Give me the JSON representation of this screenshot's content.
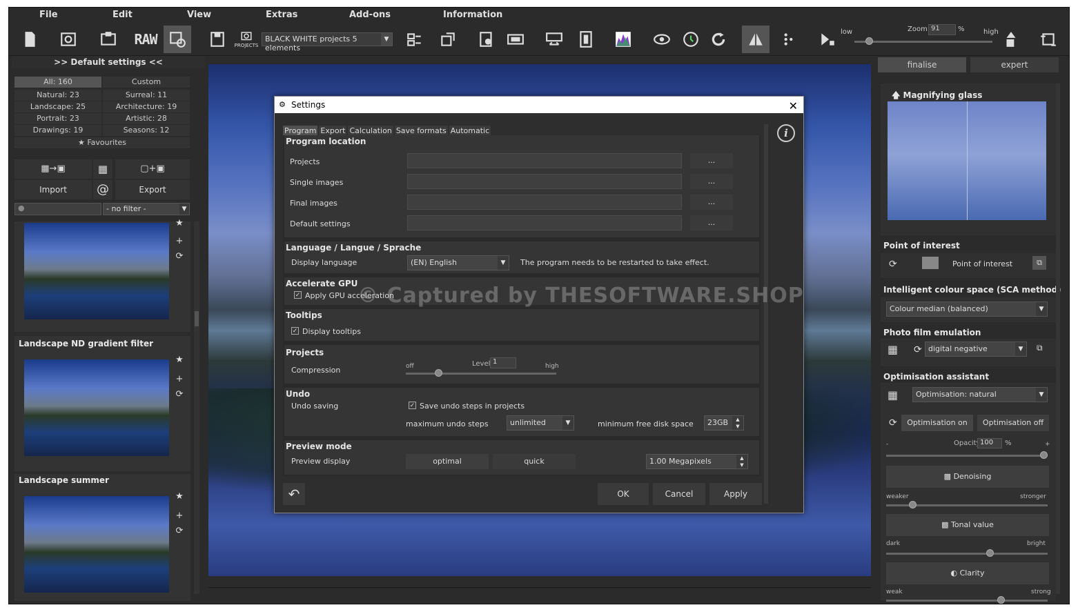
{
  "menu": [
    "File",
    "Edit",
    "View",
    "Extras",
    "Add-ons",
    "Information"
  ],
  "toolbar": {
    "raw_label": "RAW",
    "projects_label": "PROJECTS",
    "projects_select": "BLACK WHITE projects 5 elements",
    "zoom_label": "Zoom",
    "zoom_value": "91",
    "zoom_unit": "%",
    "low_label": "low",
    "high_label": "high"
  },
  "left_panel": {
    "header": ">> Default settings <<",
    "categories": [
      {
        "label": "All: 160"
      },
      {
        "label": "Custom"
      },
      {
        "label": "Natural: 23"
      },
      {
        "label": "Surreal: 11"
      },
      {
        "label": "Landscape: 25"
      },
      {
        "label": "Architecture: 19"
      },
      {
        "label": "Portrait: 23"
      },
      {
        "label": "Artistic: 28"
      },
      {
        "label": "Drawings: 19"
      },
      {
        "label": "Seasons: 12"
      }
    ],
    "favourites": "Favourites",
    "import_label": "Import",
    "export_label": "Export",
    "filter_value": "- no filter -",
    "presets": [
      {
        "title": ""
      },
      {
        "title": "Landscape ND gradient filter"
      },
      {
        "title": "Landscape summer"
      }
    ]
  },
  "right_panel": {
    "tabs": [
      "finalise",
      "expert"
    ],
    "magnifier_title": "Magnifying glass",
    "poi_title": "Point of interest",
    "poi_button": "Point of interest",
    "sca_title": "Intelligent colour space (SCA method)",
    "sca_value": "Colour median (balanced)",
    "film_title": "Photo film emulation",
    "film_value": "digital negative",
    "opt_title": "Optimisation assistant",
    "opt_value": "Optimisation: natural",
    "opt_on": "Optimisation on",
    "opt_off": "Optimisation off",
    "opacity_label": "Opacity",
    "opacity_value": "100",
    "opacity_unit": "%",
    "denoise_label": "Denoising",
    "weaker": "weaker",
    "stronger": "stronger",
    "tonal_label": "Tonal value",
    "dark": "dark",
    "bright": "bright",
    "clarity_label": "Clarity",
    "weak": "weak",
    "strong": "strong",
    "opacity_level": 1.0,
    "denoise_level": 0.15,
    "tonal_level": 0.65,
    "clarity_level": 0.72
  },
  "dialog": {
    "title": "Settings",
    "tabs": [
      "Program",
      "Export",
      "Calculation",
      "Save formats",
      "Automatic"
    ],
    "program_location": "Program location",
    "rows": [
      {
        "label": "Projects",
        "browse": "..."
      },
      {
        "label": "Single images",
        "browse": "..."
      },
      {
        "label": "Final images",
        "browse": "..."
      },
      {
        "label": "Default settings",
        "browse": "..."
      }
    ],
    "language_title": "Language / Langue / Sprache",
    "display_language": "Display language",
    "language_value": "(EN) English",
    "restart_note": "The program needs to be restarted to take effect.",
    "gpu_title": "Accelerate GPU",
    "gpu_check": "Apply GPU acceleration",
    "tooltips_title": "Tooltips",
    "tooltips_check": "Display tooltips",
    "projects_title": "Projects",
    "compression": "Compression",
    "comp_off": "off",
    "comp_level_label": "Level",
    "comp_level": "1",
    "comp_high": "high",
    "undo_title": "Undo",
    "undo_saving": "Undo saving",
    "undo_check": "Save undo steps in projects",
    "max_undo": "maximum undo steps",
    "max_undo_value": "unlimited",
    "min_disk": "minimum free disk space",
    "min_disk_value": "23GB",
    "preview_title": "Preview mode",
    "preview_display": "Preview display",
    "optimal": "optimal",
    "quick": "quick",
    "megapixels": "1.00 Megapixels",
    "ok": "OK",
    "cancel": "Cancel",
    "apply": "Apply"
  },
  "watermark": "© Captured by THESOFTWARE.SHOP"
}
